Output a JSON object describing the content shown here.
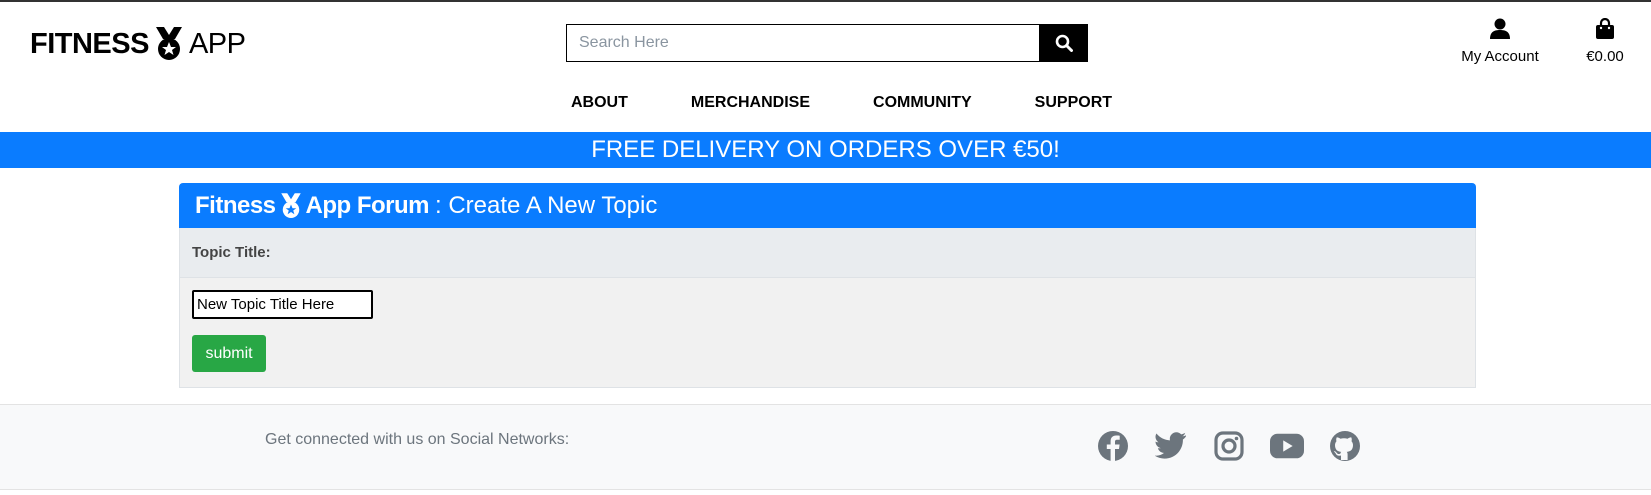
{
  "brand": {
    "word1": "FITNESS",
    "word2": "APP"
  },
  "search": {
    "placeholder": "Search Here",
    "icon": "search-icon"
  },
  "header": {
    "account_label": "My Account",
    "cart_total": "€0.00"
  },
  "nav": {
    "items": [
      "ABOUT",
      "MERCHANDISE",
      "COMMUNITY",
      "SUPPORT"
    ]
  },
  "banner": {
    "text": "FREE DELIVERY ON ORDERS OVER €50!"
  },
  "forum": {
    "brand1": "Fitness",
    "brand2": "App Forum",
    "subtitle": ": Create A New Topic",
    "field_label": "Topic Title:",
    "title_value": "New Topic Title Here",
    "submit_label": "submit"
  },
  "footer": {
    "connect_text": "Get connected with us on Social Networks:",
    "socials": [
      "facebook-icon",
      "twitter-icon",
      "instagram-icon",
      "youtube-icon",
      "github-icon"
    ]
  },
  "colors": {
    "primary": "#0a7cff",
    "success": "#28a745",
    "muted": "#6c757d",
    "footer_bg": "#f8f9fa"
  }
}
